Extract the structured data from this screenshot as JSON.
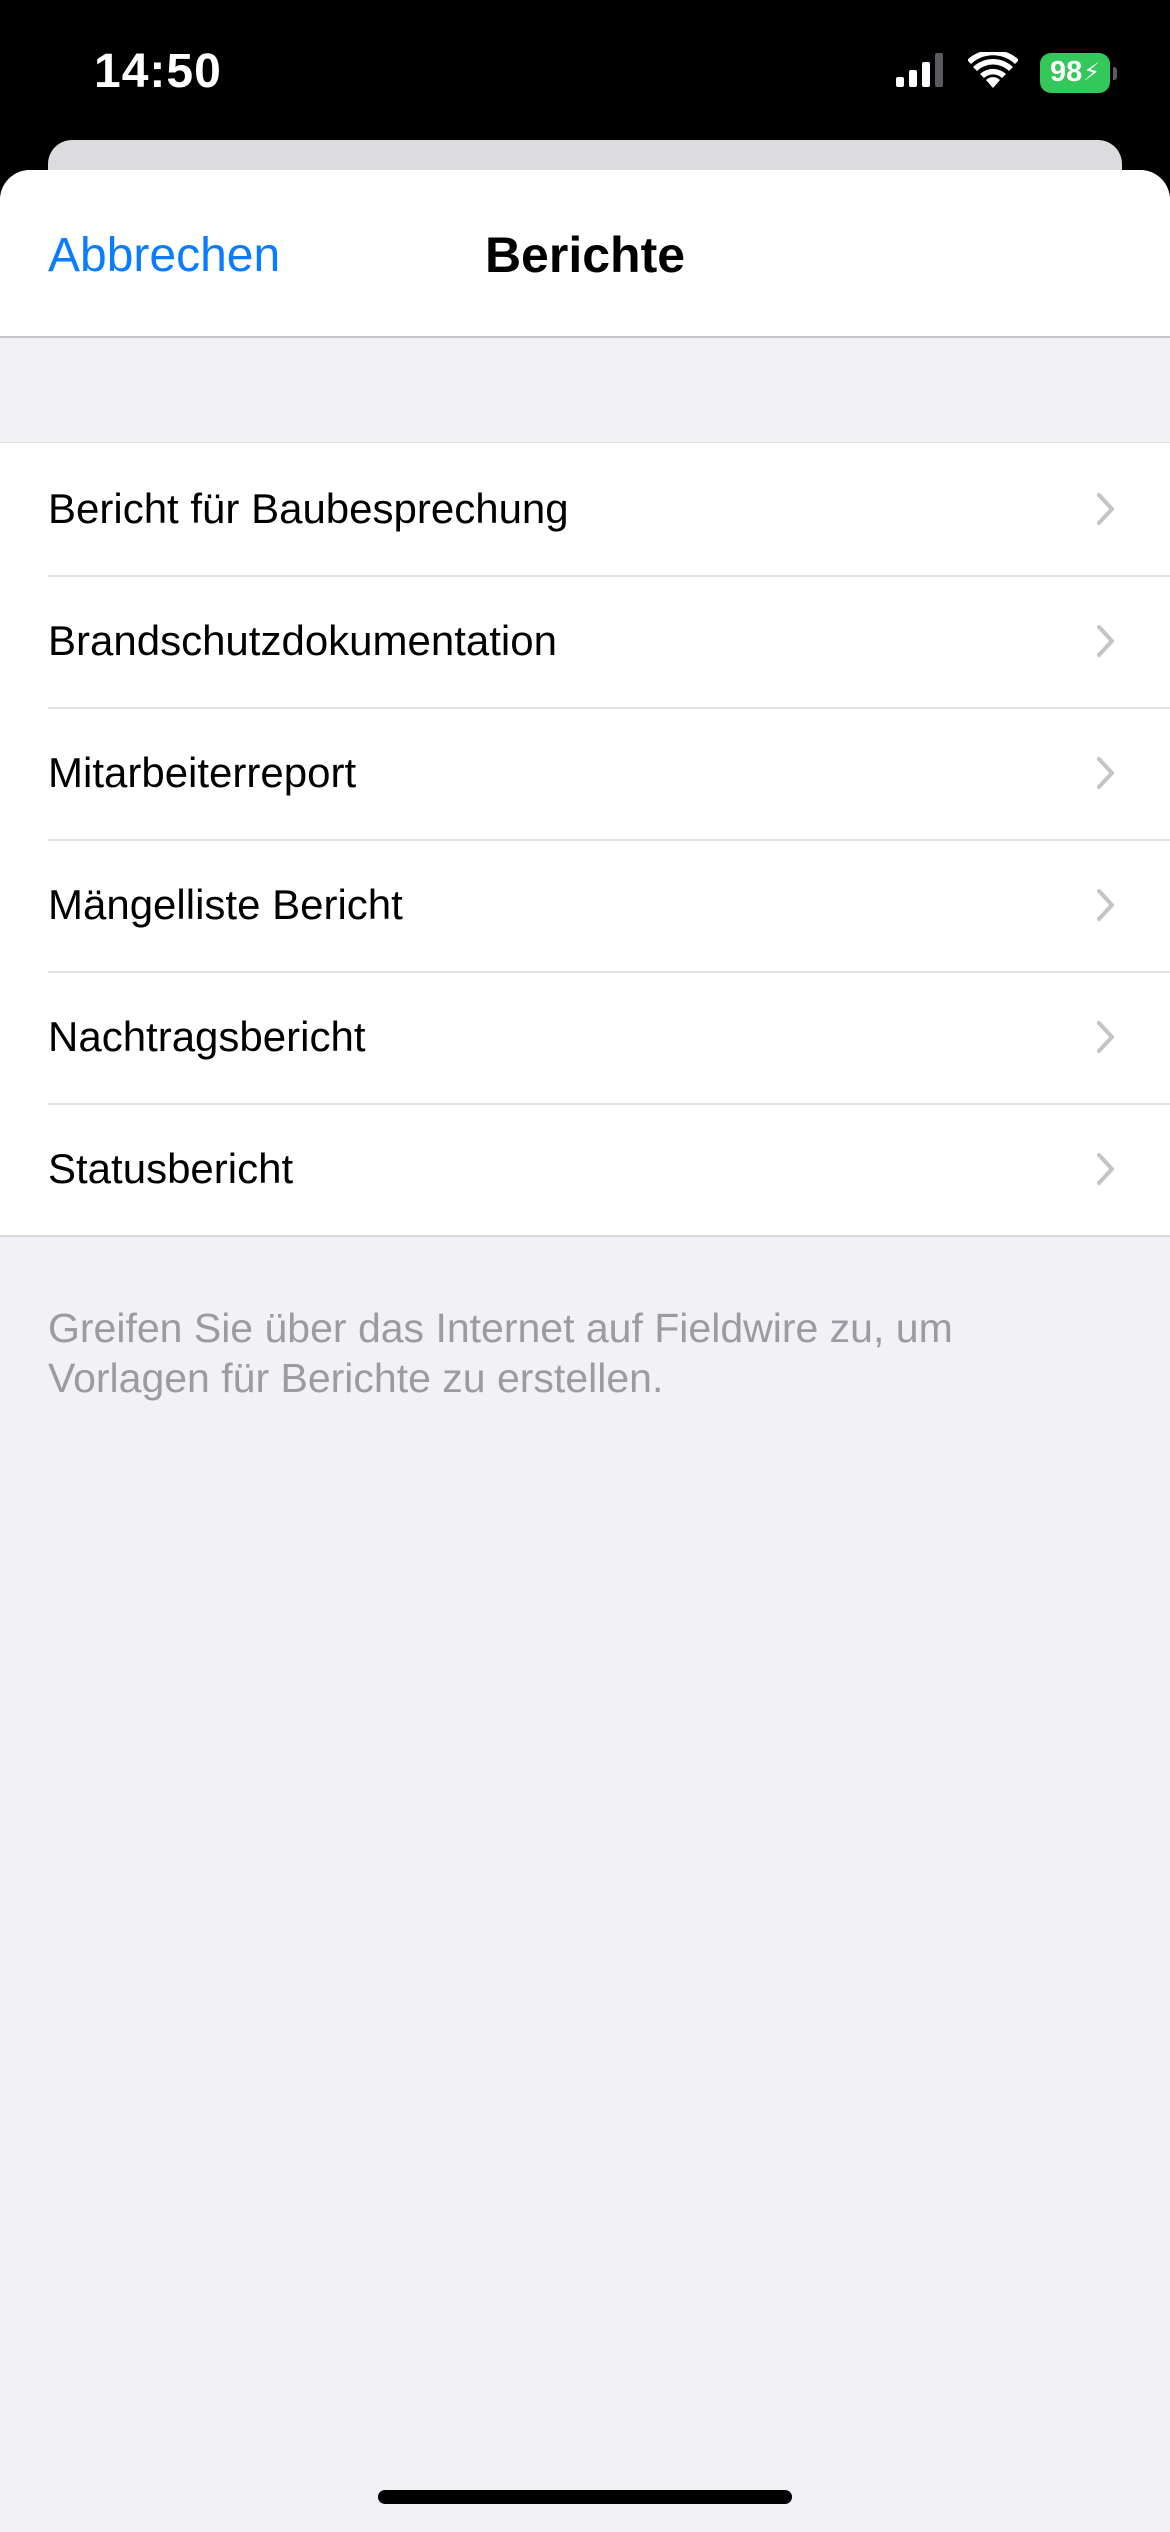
{
  "status_bar": {
    "time": "14:50",
    "battery_level": "98",
    "signal_icon": "cellular-signal-icon",
    "wifi_icon": "wifi-icon",
    "battery_color": "#34c759"
  },
  "nav": {
    "cancel_label": "Abbrechen",
    "title": "Berichte",
    "accent_color": "#0a7cff"
  },
  "reports": {
    "items": [
      {
        "label": "Bericht für Baubesprechung"
      },
      {
        "label": "Brandschutzdokumentation"
      },
      {
        "label": "Mitarbeiterreport"
      },
      {
        "label": "Mängelliste Bericht"
      },
      {
        "label": "Nachtragsbericht"
      },
      {
        "label": "Statusbericht"
      }
    ],
    "chevron_icon": "chevron-right-icon"
  },
  "footer": {
    "note": "Greifen Sie über das Internet auf Fieldwire zu, um Vorlagen für Berichte zu erstellen."
  }
}
